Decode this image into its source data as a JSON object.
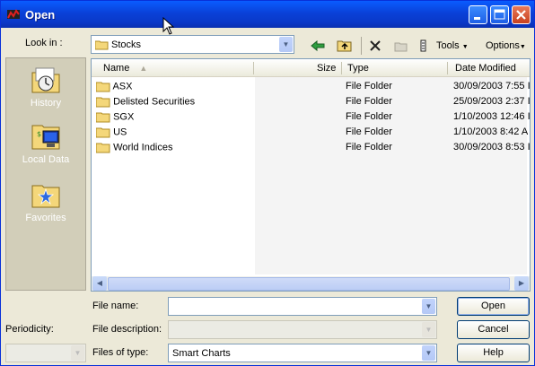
{
  "window": {
    "title": "Open"
  },
  "lookin": {
    "label": "Look in :",
    "value": "Stocks"
  },
  "toolbar": {
    "tools_label": "Tools",
    "options_label": "Options"
  },
  "places": [
    {
      "label": "History"
    },
    {
      "label": "Local Data"
    },
    {
      "label": "Favorites"
    }
  ],
  "columns": {
    "name": "Name",
    "size": "Size",
    "type": "Type",
    "modified": "Date Modified"
  },
  "files": [
    {
      "name": "ASX",
      "size": "",
      "type": "File Folder",
      "modified": "30/09/2003 7:55 I"
    },
    {
      "name": "Delisted Securities",
      "size": "",
      "type": "File Folder",
      "modified": "25/09/2003 2:37 I"
    },
    {
      "name": "SGX",
      "size": "",
      "type": "File Folder",
      "modified": "1/10/2003 12:46 I"
    },
    {
      "name": "US",
      "size": "",
      "type": "File Folder",
      "modified": "1/10/2003 8:42 A"
    },
    {
      "name": "World Indices",
      "size": "",
      "type": "File Folder",
      "modified": "30/09/2003 8:53 I"
    }
  ],
  "form": {
    "file_name_label": "File name:",
    "file_name_value": "",
    "file_desc_label": "File description:",
    "file_desc_value": "",
    "files_type_label": "Files of type:",
    "files_type_value": "Smart Charts",
    "periodicity_label": "Periodicity:",
    "periodicity_value": ""
  },
  "buttons": {
    "open": "Open",
    "cancel": "Cancel",
    "help": "Help"
  },
  "colors": {
    "titlebar": "#0a41d8",
    "panel": "#ece9d8",
    "places_bg": "#d2ceb9"
  }
}
